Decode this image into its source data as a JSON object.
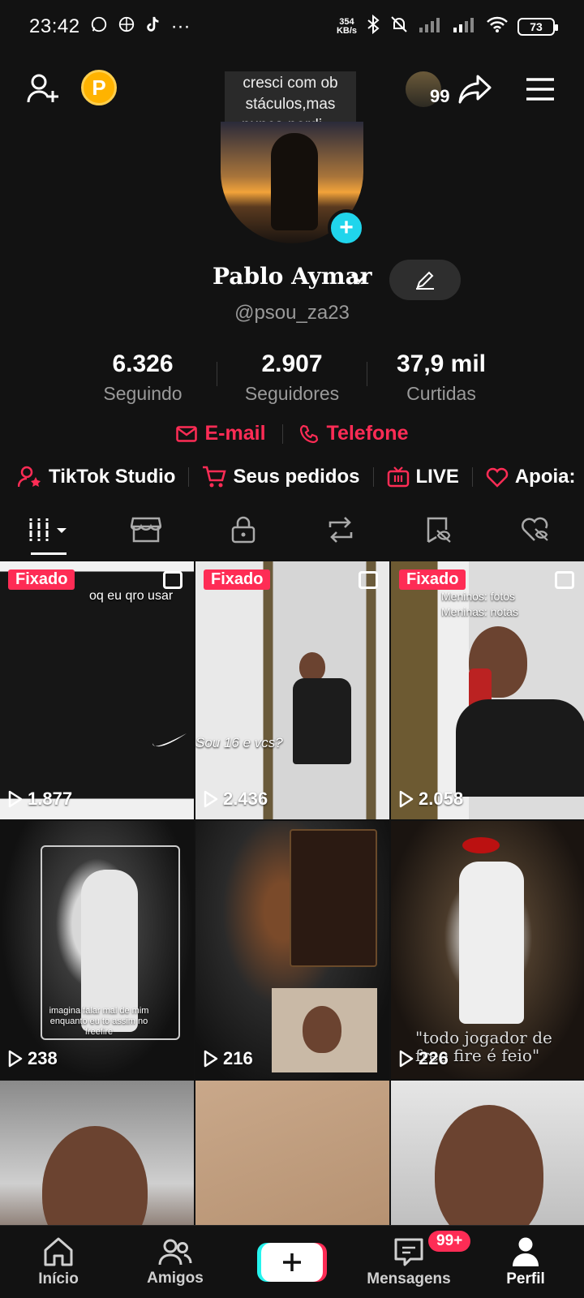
{
  "status_bar": {
    "time": "23:42",
    "net_speed_value": "354",
    "net_speed_unit": "KB/s",
    "battery": "73"
  },
  "header": {
    "bio_bubble": "cresci com ob stáculos,mas nunca perdi ...",
    "friends_count": "99"
  },
  "profile": {
    "display_name": "Pablo Aymar",
    "username": "@psou_za23"
  },
  "stats": [
    {
      "value": "6.326",
      "label": "Seguindo"
    },
    {
      "value": "2.907",
      "label": "Seguidores"
    },
    {
      "value": "37,9 mil",
      "label": "Curtidas"
    }
  ],
  "contact": {
    "email": "E-mail",
    "phone": "Telefone"
  },
  "tools": [
    {
      "label": "TikTok Studio"
    },
    {
      "label": "Seus pedidos"
    },
    {
      "label": "LIVE"
    },
    {
      "label": "Apoia:"
    }
  ],
  "videos": [
    {
      "views": "1.877",
      "pinned": "Fixado",
      "overlay": "oq eu qro usar"
    },
    {
      "views": "2.436",
      "pinned": "Fixado",
      "overlay": "Sou 16 e vcs?"
    },
    {
      "views": "2.058",
      "pinned": "Fixado",
      "overlay": "Meninos: fotos\nMeninas: notas"
    },
    {
      "views": "238",
      "overlay": "imagina falar mal de mim enquanto eu to assim no freefire"
    },
    {
      "views": "216"
    },
    {
      "views": "226",
      "overlay": "\"todo jogador de free fire é feio\""
    },
    {},
    {},
    {}
  ],
  "bottom_nav": {
    "home": "Início",
    "friends": "Amigos",
    "messages": "Mensagens",
    "messages_badge": "99+",
    "profile": "Perfil"
  }
}
